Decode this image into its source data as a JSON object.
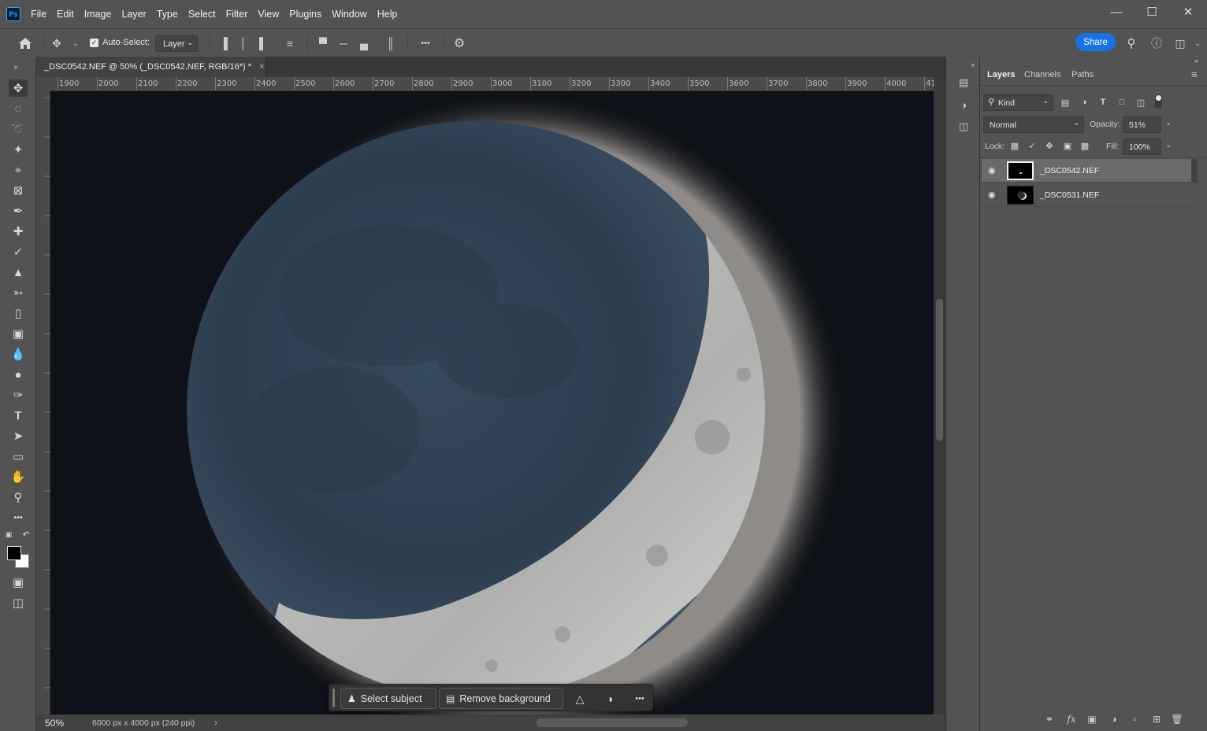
{
  "app": {
    "logo": "Ps"
  },
  "menu": [
    "File",
    "Edit",
    "Image",
    "Layer",
    "Type",
    "Select",
    "Filter",
    "View",
    "Plugins",
    "Window",
    "Help"
  ],
  "options": {
    "auto_select_label": "Auto-Select:",
    "auto_select_checked": true,
    "target": "Layer",
    "more_label": "•••",
    "share_label": "Share"
  },
  "document": {
    "tab_title": "_DSC0542.NEF @ 50% (_DSC0542.NEF, RGB/16*) *",
    "zoom": "50%",
    "size_info": "6000 px x 4000 px (240 ppi)",
    "ruler_labels": [
      "1900",
      "2000",
      "2100",
      "2200",
      "2300",
      "2400",
      "2500",
      "2600",
      "2700",
      "2800",
      "2900",
      "3000",
      "3100",
      "3200",
      "3300",
      "3400",
      "3500",
      "3600",
      "3700",
      "3800",
      "3900",
      "4000",
      "41"
    ]
  },
  "taskbar": {
    "select_subject": "Select subject",
    "remove_background": "Remove background",
    "more": "•••"
  },
  "panels": {
    "tabs": [
      "Layers",
      "Channels",
      "Paths"
    ],
    "active_tab": "Layers",
    "filter_kind": "Kind",
    "blend_mode": "Normal",
    "opacity_label": "Opacity:",
    "opacity": "51%",
    "lock_label": "Lock:",
    "fill_label": "Fill:",
    "fill": "100%",
    "layers": [
      {
        "name": "_DSC0542.NEF",
        "visible": true,
        "selected": true
      },
      {
        "name": "_DSC0531.NEF",
        "visible": true,
        "selected": false
      }
    ]
  },
  "colors": {
    "accent": "#1473e6",
    "panel_bg": "#535353",
    "canvas_bg": "#0e1117"
  }
}
